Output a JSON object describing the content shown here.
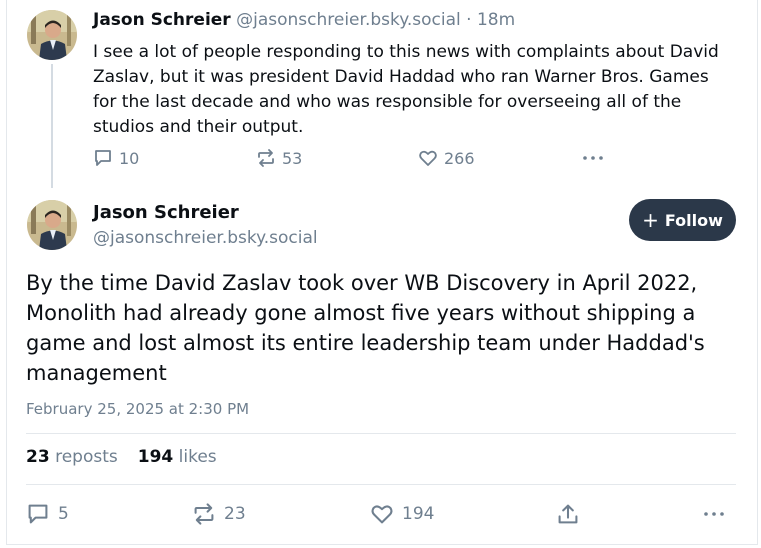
{
  "reply_post": {
    "author_name": "Jason Schreier",
    "author_handle": "@jasonschreier.bsky.social",
    "separator": "·",
    "time_ago": "18m",
    "text": "I see a lot of people responding to this news with complaints about David Zaslav, but it was president David Haddad who ran Warner Bros. Games for the last decade and who was responsible for overseeing all of the studios and their output.",
    "reply_count": "10",
    "repost_count": "53",
    "like_count": "266"
  },
  "main_post": {
    "author_name": "Jason Schreier",
    "author_handle": "@jasonschreier.bsky.social",
    "follow_label": "Follow",
    "text": "By the time David Zaslav took over WB Discovery in April 2022, Monolith had already gone almost five years without shipping a game and lost almost its entire leadership team under Haddad's management",
    "date": "February 25, 2025 at 2:30 PM",
    "stats": {
      "reposts_count": "23",
      "reposts_label": "reposts",
      "likes_count": "194",
      "likes_label": "likes"
    },
    "reply_count": "5",
    "repost_count": "23",
    "like_count": "194"
  },
  "icons": {
    "reply": "speech-bubble-icon",
    "repost": "repost-arrows-icon",
    "like": "heart-icon",
    "share": "share-upload-icon",
    "more": "more-dots-icon"
  },
  "colors": {
    "text_primary": "#0b0f14",
    "text_muted": "#6f7f8f",
    "follow_bg": "#2b3849",
    "divider": "#e4e8ec"
  }
}
